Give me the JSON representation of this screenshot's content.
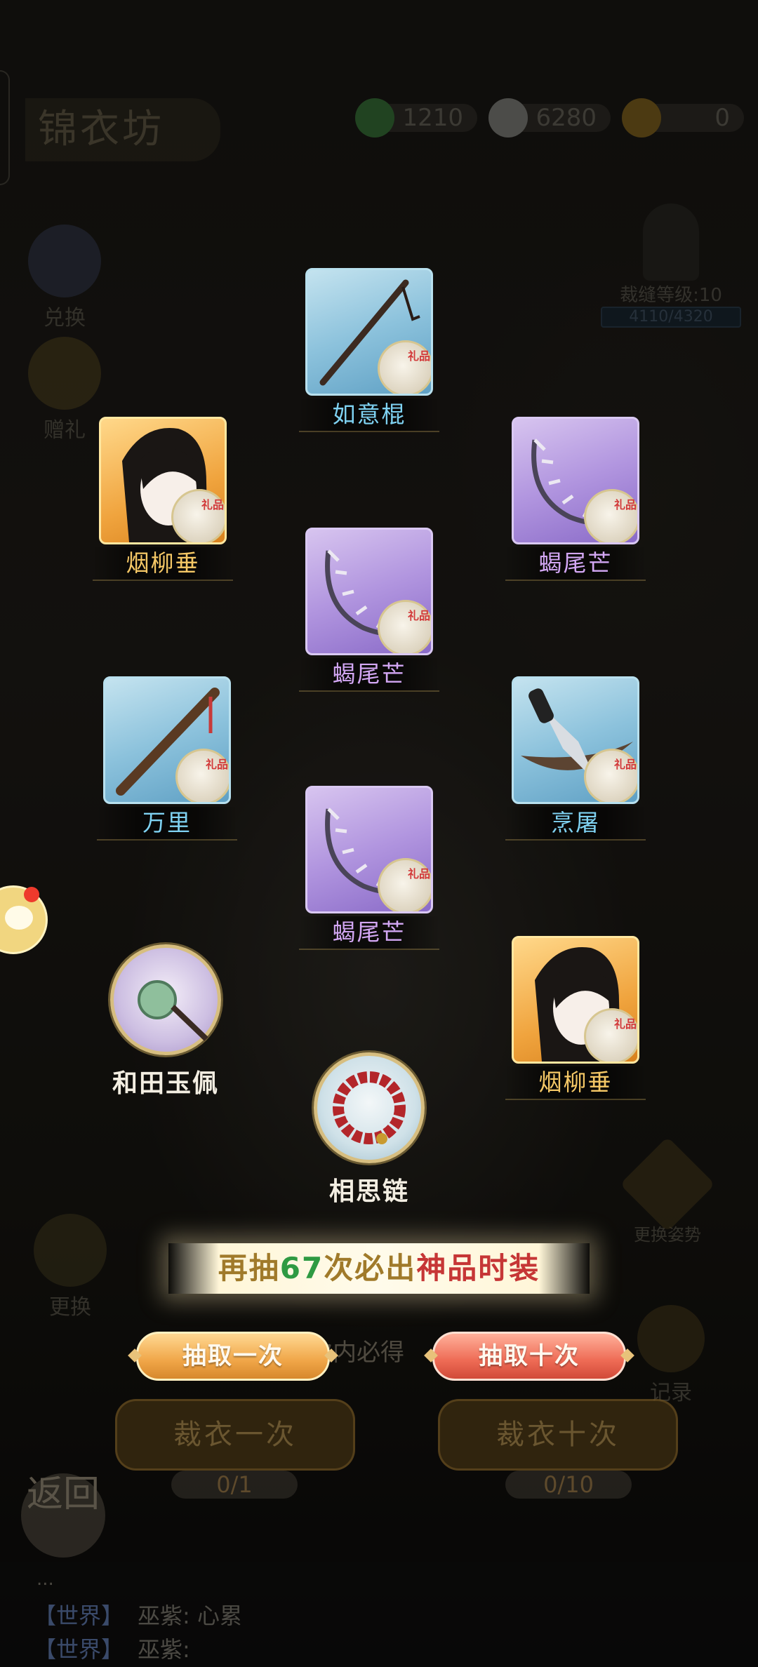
{
  "header": {
    "title": "锦衣坊",
    "currencies": [
      {
        "icon": "jade-coin-icon",
        "value": "1210"
      },
      {
        "icon": "silver-ingot-icon",
        "value": "6280"
      },
      {
        "icon": "gold-ingot-icon",
        "value": "0"
      }
    ]
  },
  "side_left": {
    "exchange_label": "兑换",
    "gift_label": "赠礼",
    "change_label": "更换"
  },
  "side_right": {
    "level_label": "裁缝等级:10",
    "level_progress": "4110/4320",
    "pose_label": "更换姿势",
    "record_label": "记录"
  },
  "rewards": [
    {
      "name": "如意棍",
      "rarity": "blue",
      "kind": "card"
    },
    {
      "name": "烟柳垂",
      "rarity": "gold",
      "kind": "card"
    },
    {
      "name": "蝎尾芒",
      "rarity": "purple",
      "kind": "card"
    },
    {
      "name": "蝎尾芒",
      "rarity": "purple",
      "kind": "card"
    },
    {
      "name": "万里",
      "rarity": "blue",
      "kind": "card"
    },
    {
      "name": "烹屠",
      "rarity": "blue",
      "kind": "card"
    },
    {
      "name": "蝎尾芒",
      "rarity": "purple",
      "kind": "card"
    },
    {
      "name": "和田玉佩",
      "rarity": "purple",
      "kind": "round"
    },
    {
      "name": "烟柳垂",
      "rarity": "gold",
      "kind": "card"
    },
    {
      "name": "相思链",
      "rarity": "white",
      "kind": "round"
    }
  ],
  "pity": {
    "prefix": "再抽",
    "count": "67",
    "middle": "次必出",
    "highlight": "神品时装"
  },
  "buttons": {
    "draw_one": "抽取一次",
    "draw_ten": "抽取十次",
    "guarantee_text": "次内必得",
    "cut_one": "裁衣一次",
    "cut_ten": "裁衣十次",
    "cost_one": "0/1",
    "cost_ten": "0/10",
    "back": "返回"
  },
  "chat": {
    "ellipsis": "...",
    "lines": [
      {
        "channel": "【世界】",
        "text": "巫紫: 心累"
      },
      {
        "channel": "【世界】",
        "text": "巫紫:"
      }
    ]
  },
  "colors": {
    "blue_card": "#8cc2dc",
    "purple_card": "#b195df",
    "gold_card": "#f0a43e",
    "draw_one_button": "#f0a648",
    "draw_ten_button": "#ee6b55"
  }
}
